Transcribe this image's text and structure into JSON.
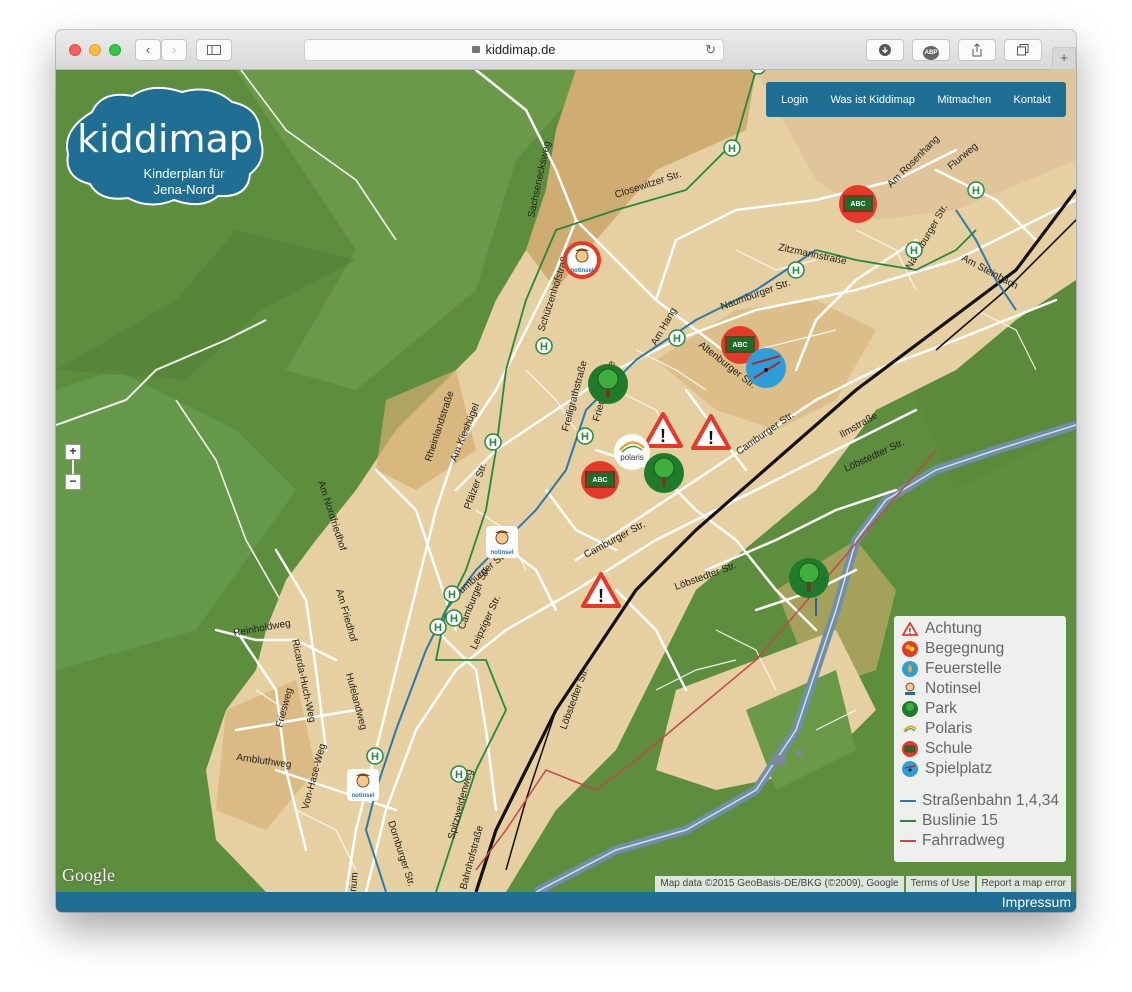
{
  "browser": {
    "url": "kiddimap.de",
    "icons": [
      "back-icon",
      "forward-icon",
      "sidebar-icon",
      "lock-icon",
      "reload-icon",
      "download-icon",
      "adblock-icon",
      "share-icon",
      "tabs-icon",
      "new-tab-icon"
    ],
    "adblock_label": "ABP",
    "new_tab_label": "+"
  },
  "logo": {
    "title": "kiddimap",
    "subtitle_line1": "Kinderplan für",
    "subtitle_line2": "Jena-Nord"
  },
  "nav": {
    "items": [
      "Login",
      "Was ist Kiddimap",
      "Mitmachen",
      "Kontakt"
    ]
  },
  "zoom": {
    "in_label": "+",
    "out_label": "−"
  },
  "map": {
    "streets": [
      "Sachsenecksweg",
      "Closewitzer Str.",
      "Schützenhofstraße",
      "Am Hang",
      "Freiligrathstraße",
      "Friedenstraße",
      "Naumburger Str.",
      "Zitzmannstraße",
      "Am Rosenhang",
      "Flurweg",
      "Am Steinbach",
      "Altenburger Str.",
      "Camburger Str.",
      "Ilmstraße",
      "Löbstedter Str.",
      "Rheinlandstraße",
      "Am Kieshügel",
      "Pfälzer Str.",
      "Am Nordfriedhof",
      "Am Friedhof",
      "Reinholdweg",
      "Ricarda-Huch-Weg",
      "Friesweg",
      "Hufelandweg",
      "Von-Hase-Weg",
      "Leipziger Str.",
      "Spitzweidenweg",
      "Dornburger Str.",
      "Bahnhofstraße",
      "Arnbluthweg",
      "rium"
    ],
    "poi_text": {
      "abc": "ABC",
      "notinsel": "notinsel",
      "polaris": "polaris"
    },
    "bus_stop_label": "H",
    "colors": {
      "forest": "#5d8e3d",
      "urban": "#e6cfa0",
      "tram": "#2a7ab0",
      "bus": "#228b3c",
      "bike": "#c8464b",
      "river": "#6f8ea8",
      "rail": "#111111"
    }
  },
  "legend": {
    "items": [
      {
        "label": "Achtung",
        "icon": "warning-icon"
      },
      {
        "label": "Begegnung",
        "icon": "meeting-icon"
      },
      {
        "label": "Feuerstelle",
        "icon": "fireplace-icon"
      },
      {
        "label": "Notinsel",
        "icon": "notinsel-icon"
      },
      {
        "label": "Park",
        "icon": "park-icon"
      },
      {
        "label": "Polaris",
        "icon": "polaris-icon"
      },
      {
        "label": "Schule",
        "icon": "school-icon"
      },
      {
        "label": "Spielplatz",
        "icon": "playground-icon"
      }
    ],
    "lines": [
      {
        "label": "Straßenbahn 1,4,34",
        "color": "#2a7ab0"
      },
      {
        "label": "Buslinie 15",
        "color": "#228b3c"
      },
      {
        "label": "Fahrradweg",
        "color": "#c8464b"
      }
    ]
  },
  "attribution": {
    "google": "Google",
    "data": "Map data ©2015 GeoBasis-DE/BKG (©2009), Google",
    "terms": "Terms of Use",
    "report": "Report a map error"
  },
  "footer": {
    "impressum": "Impressum"
  }
}
